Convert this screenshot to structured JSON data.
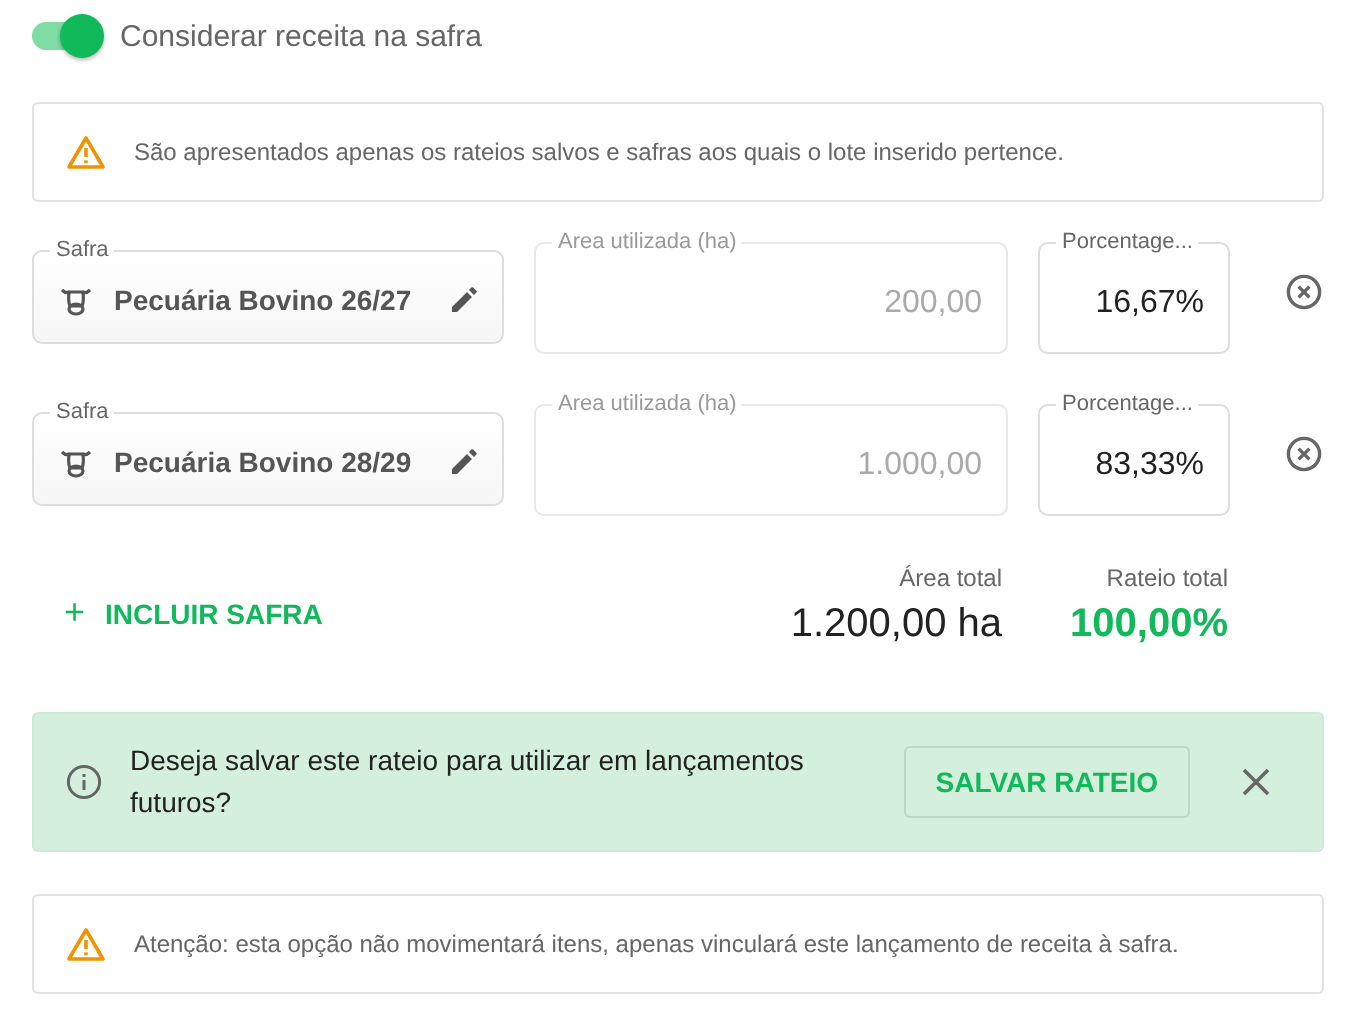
{
  "toggle": {
    "label": "Considerar receita na safra",
    "on": true
  },
  "info_notice": {
    "text": "São apresentados apenas os rateios salvos e safras aos quais o lote inserido pertence."
  },
  "rows": [
    {
      "safra": {
        "label": "Safra",
        "value": "Pecuária Bovino 26/27"
      },
      "area": {
        "label": "Area utilizada (ha)",
        "value": "200,00",
        "disabled": true
      },
      "percent": {
        "label": "Porcentage...",
        "value": "16,67%"
      }
    },
    {
      "safra": {
        "label": "Safra",
        "value": "Pecuária Bovino 28/29"
      },
      "area": {
        "label": "Area utilizada (ha)",
        "value": "1.000,00",
        "disabled": true
      },
      "percent": {
        "label": "Porcentage...",
        "value": "83,33%"
      }
    }
  ],
  "add_button": {
    "icon": "+",
    "label": "INCLUIR SAFRA"
  },
  "totals": [
    {
      "label": "Área total",
      "value": "1.200,00 ha",
      "kind": "plain"
    },
    {
      "label": "Rateio total",
      "value": "100,00%",
      "kind": "success"
    }
  ],
  "save_banner": {
    "text": "Deseja salvar este rateio para utilizar em lançamentos futuros?",
    "button": "SALVAR RATEIO"
  },
  "warning_notice": {
    "text": "Atenção: esta opção não movimentará itens, apenas vinculará este lançamento de receita à safra."
  }
}
